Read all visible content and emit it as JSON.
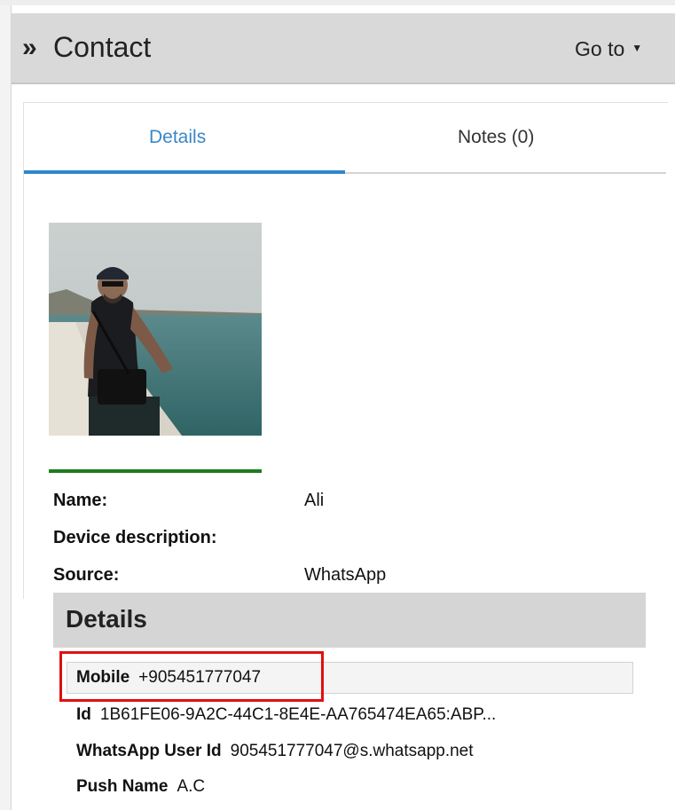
{
  "header": {
    "chevron_glyph": "»",
    "title": "Contact",
    "goto_label": "Go to",
    "caret_glyph": "▼"
  },
  "tabs": [
    {
      "label": "Details",
      "active": true
    },
    {
      "label": "Notes (0)",
      "active": false
    }
  ],
  "contact": {
    "fields": [
      {
        "label": "Name:",
        "value": "Ali"
      },
      {
        "label": "Device description:",
        "value": ""
      },
      {
        "label": "Source:",
        "value": "WhatsApp"
      }
    ]
  },
  "details": {
    "heading": "Details",
    "mobile": {
      "label": "Mobile",
      "value": "+905451777047"
    },
    "id": {
      "label": "Id",
      "value": "1B61FE06-9A2C-44C1-8E4E-AA765474EA65:ABP..."
    },
    "whatsapp_user_id": {
      "label": "WhatsApp User Id",
      "value": "905451777047@s.whatsapp.net"
    },
    "push_name": {
      "label": "Push Name",
      "value": "A.C"
    }
  },
  "colors": {
    "accent": "#2f86c9",
    "status_line": "#1e7d1e",
    "highlight": "#e01010"
  }
}
